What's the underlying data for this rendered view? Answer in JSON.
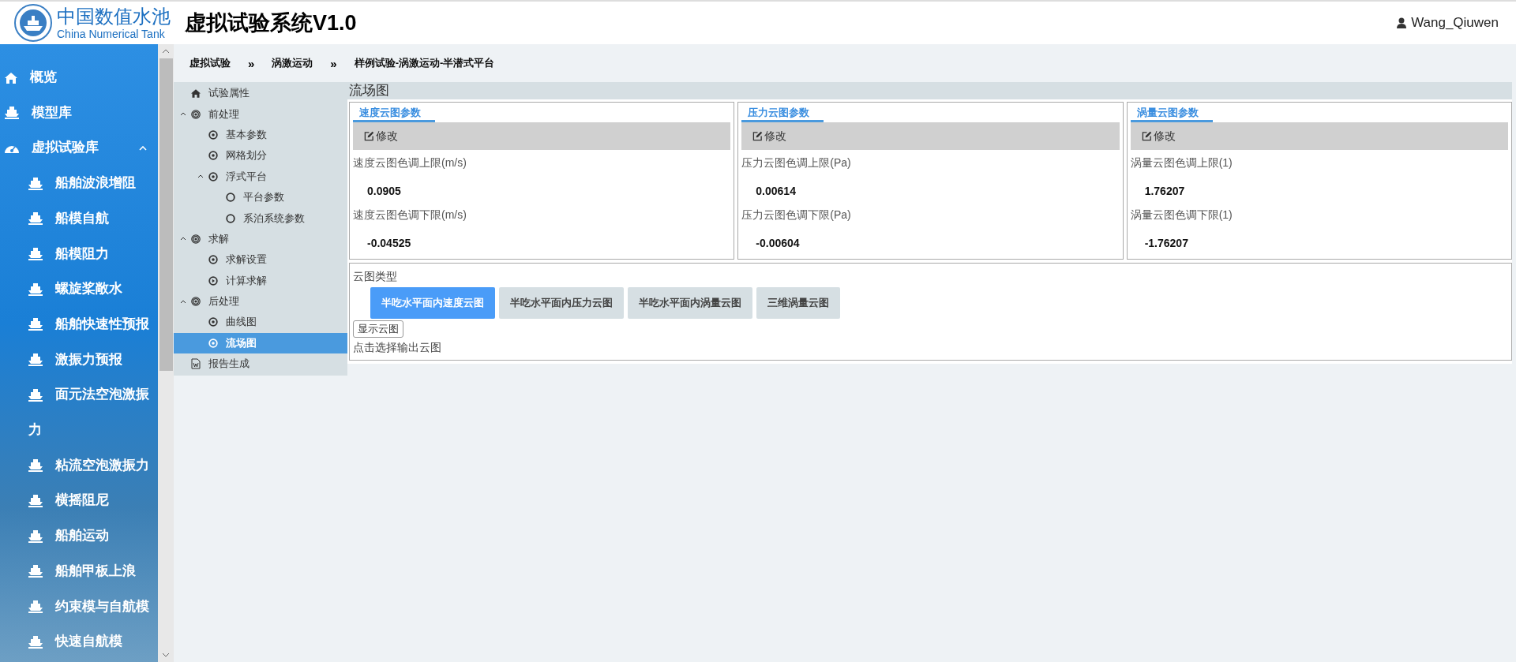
{
  "header": {
    "logo_cn": "中国数值水池",
    "logo_en": "China Numerical Tank",
    "title": "虚拟试验系统V1.0",
    "user": "Wang_Qiuwen"
  },
  "sidebar": {
    "items": [
      {
        "label": "概览",
        "kind": "home"
      },
      {
        "label": "模型库",
        "kind": "ship"
      },
      {
        "label": "虚拟试验库",
        "kind": "dashboard",
        "expanded": true,
        "children": [
          {
            "label": "船舶波浪增阻"
          },
          {
            "label": "船模自航"
          },
          {
            "label": "船模阻力"
          },
          {
            "label": "螺旋桨敞水"
          },
          {
            "label": "船舶快速性预报"
          },
          {
            "label": "激振力预报"
          },
          {
            "label": "面元法空泡激振力"
          },
          {
            "label": "粘流空泡激振力"
          },
          {
            "label": "横摇阻尼"
          },
          {
            "label": "船舶运动"
          },
          {
            "label": "船舶甲板上浪"
          },
          {
            "label": "约束模与自航模"
          },
          {
            "label": "快速自航模"
          }
        ]
      }
    ]
  },
  "breadcrumb": {
    "separator": "»",
    "items": [
      "虚拟试验",
      "涡激运动",
      "样例试验-涡激运动-半潜式平台"
    ]
  },
  "tree": [
    {
      "label": "试验属性",
      "kind": "home",
      "selected": false
    },
    {
      "label": "前处理",
      "kind": "group",
      "expanded": true,
      "selected": false,
      "children": [
        {
          "label": "基本参数",
          "kind": "step",
          "selected": false
        },
        {
          "label": "网格划分",
          "kind": "step",
          "selected": false
        },
        {
          "label": "浮式平台",
          "kind": "step",
          "expanded": true,
          "selected": false,
          "children": [
            {
              "label": "平台参数",
              "kind": "leaf",
              "selected": false
            },
            {
              "label": "系泊系统参数",
              "kind": "leaf",
              "selected": false
            }
          ]
        }
      ]
    },
    {
      "label": "求解",
      "kind": "group",
      "expanded": true,
      "selected": false,
      "children": [
        {
          "label": "求解设置",
          "kind": "step",
          "selected": false
        },
        {
          "label": "计算求解",
          "kind": "run",
          "selected": false
        }
      ]
    },
    {
      "label": "后处理",
      "kind": "group",
      "expanded": true,
      "selected": false,
      "children": [
        {
          "label": "曲线图",
          "kind": "step",
          "selected": false
        },
        {
          "label": "流场图",
          "kind": "step",
          "selected": true
        }
      ]
    },
    {
      "label": "报告生成",
      "kind": "report",
      "selected": false
    }
  ],
  "content": {
    "title": "流场图",
    "panels": [
      {
        "title": "速度云图参数",
        "edit": "修改",
        "fields": [
          {
            "label": "速度云图色调上限(m/s)",
            "value": "0.0905"
          },
          {
            "label": "速度云图色调下限(m/s)",
            "value": "-0.04525"
          }
        ]
      },
      {
        "title": "压力云图参数",
        "edit": "修改",
        "fields": [
          {
            "label": "压力云图色调上限(Pa)",
            "value": "0.00614"
          },
          {
            "label": "压力云图色调下限(Pa)",
            "value": "-0.00604"
          }
        ]
      },
      {
        "title": "涡量云图参数",
        "edit": "修改",
        "fields": [
          {
            "label": "涡量云图色调上限(1)",
            "value": "1.76207"
          },
          {
            "label": "涡量云图色调下限(1)",
            "value": "-1.76207"
          }
        ]
      }
    ],
    "cloud_type": {
      "label": "云图类型",
      "options": [
        {
          "label": "半吃水平面内速度云图",
          "selected": true
        },
        {
          "label": "半吃水平面内压力云图",
          "selected": false
        },
        {
          "label": "半吃水平面内涡量云图",
          "selected": false
        },
        {
          "label": "三维涡量云图",
          "selected": false
        }
      ],
      "show_button": "显示云图",
      "hint": "点击选择输出云图"
    }
  }
}
